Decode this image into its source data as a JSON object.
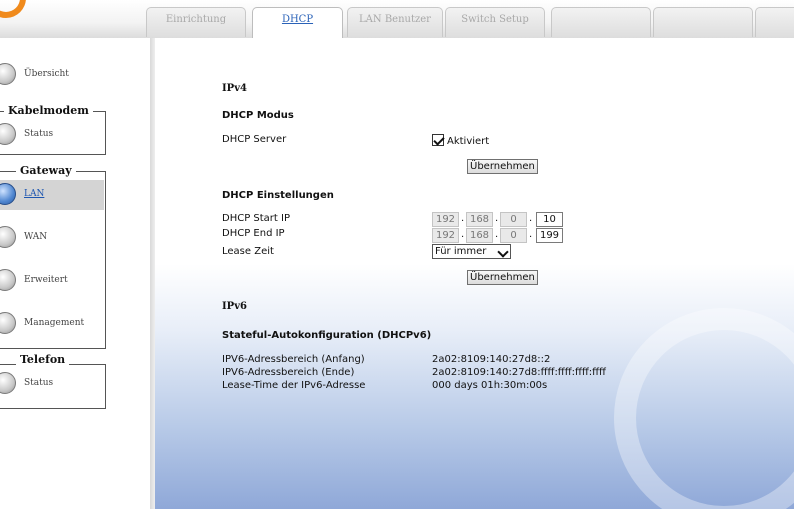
{
  "tabs": [
    {
      "label": "Einrichtung",
      "active": false
    },
    {
      "label": "DHCP",
      "active": true
    },
    {
      "label": "LAN Benutzer",
      "active": false
    },
    {
      "label": "Switch Setup",
      "active": false
    },
    {
      "label": "",
      "active": false
    },
    {
      "label": "",
      "active": false
    },
    {
      "label": "",
      "active": false
    }
  ],
  "sidebar": {
    "overview": {
      "label": "Übersicht",
      "icon": "list-icon"
    },
    "groups": [
      {
        "title": "Kabelmodem",
        "items": [
          {
            "label": "Status",
            "icon": "wrench-icon"
          }
        ]
      },
      {
        "title": "Gateway",
        "items": [
          {
            "label": "LAN",
            "icon": "network-icon",
            "active": true
          },
          {
            "label": "WAN",
            "icon": "globe-icon"
          },
          {
            "label": "Erweitert",
            "icon": "advanced-icon"
          },
          {
            "label": "Management",
            "icon": "gear-icon"
          }
        ]
      },
      {
        "title": "Telefon",
        "items": [
          {
            "label": "Status",
            "icon": "phone-icon"
          }
        ]
      }
    ]
  },
  "content": {
    "ipv4_title": "IPv4",
    "dhcp_mode": {
      "title": "DHCP Modus",
      "server_label": "DHCP Server",
      "server_checked": true,
      "server_value": "Aktiviert",
      "apply_label": "Übernehmen"
    },
    "dhcp_settings": {
      "title": "DHCP Einstellungen",
      "start_ip_label": "DHCP Start IP",
      "start_ip": [
        "192",
        "168",
        "0",
        "10"
      ],
      "end_ip_label": "DHCP End IP",
      "end_ip": [
        "192",
        "168",
        "0",
        "199"
      ],
      "lease_label": "Lease Zeit",
      "lease_value": "Für immer",
      "apply_label": "Übernehmen"
    },
    "ipv6_title": "IPv6",
    "stateful": {
      "title": "Stateful-Autokonfiguration (DHCPv6)",
      "rows": [
        {
          "label": "IPV6-Adressbereich (Anfang)",
          "value": "2a02:8109:140:27d8::2"
        },
        {
          "label": "IPV6-Adressbereich (Ende)",
          "value": "2a02:8109:140:27d8:ffff:ffff:ffff:ffff"
        },
        {
          "label": "Lease-Time der IPv6-Adresse",
          "value": "000 days 01h:30m:00s"
        }
      ]
    }
  },
  "colors": {
    "accent_orange": "#f08a1c",
    "link_blue": "#1e56b0",
    "content_gradient_bottom": "#8fa8d8"
  }
}
